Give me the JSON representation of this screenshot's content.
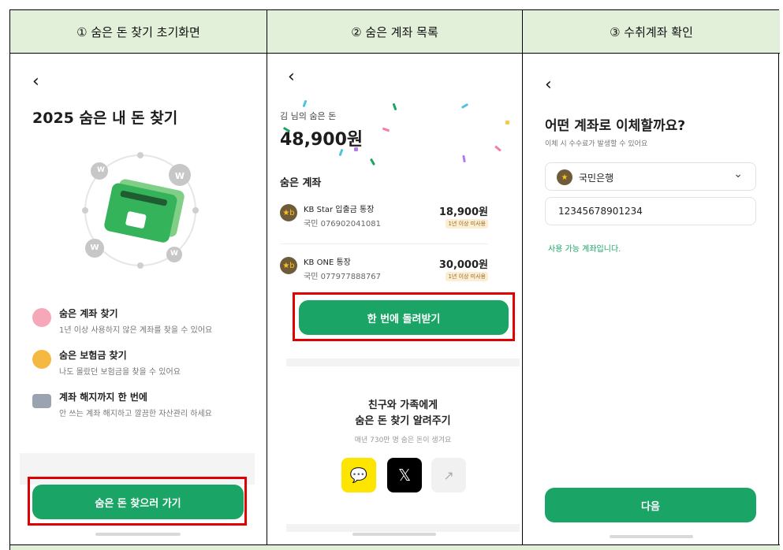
{
  "headers": [
    "① 숨은 돈 찾기 초기화면",
    "② 숨은 계좌 목록",
    "③ 수취계좌 확인"
  ],
  "colors": {
    "header_bg": "#e2f0d9",
    "brand_green": "#1aa566",
    "highlight_red": "#e00000"
  },
  "panel1": {
    "back_icon": "chevron-left-icon",
    "back_glyph": "‹",
    "title": "2025 숨은 내 돈 찾기",
    "coin_glyph": "W",
    "features": [
      {
        "icon": "piggy-bank-icon",
        "title": "숨은 계좌 찾기",
        "desc": "1년 이상 사용하지 않은 계좌를 찾을 수 있어요"
      },
      {
        "icon": "money-bag-icon",
        "title": "숨은 보험금 찾기",
        "desc": "나도 몰랐던 보험금을 찾을 수 있어요"
      },
      {
        "icon": "card-icon",
        "title": "계좌 해지까지 한 번에",
        "desc": "안 쓰는 계좌 해지하고 깔끔한 자산관리 하세요"
      }
    ],
    "cta": "숨은 돈 찾으러 가기"
  },
  "panel2": {
    "back_glyph": "‹",
    "owner": "김    님의 숨은 돈",
    "amount": "48,900원",
    "section": "숨은 계좌",
    "accounts": [
      {
        "name": "KB Star 입출금 통장",
        "number": "국민 076902041081",
        "amount": "18,900원",
        "badge": "1년 이상 미사용"
      },
      {
        "name": "KB ONE 통장",
        "number": "국민 077977888767",
        "amount": "30,000원",
        "badge": "1년 이상 미사용"
      }
    ],
    "kb_glyph": "★b",
    "cta": "한 번에 돌려받기",
    "share_title_1": "친구와 가족에게",
    "share_title_2": "숨은 돈 찾기 알려주기",
    "share_sub": "매년 730만 명 숨은 돈이 생겨요",
    "share_buttons": [
      {
        "icon": "kakao-talk-icon",
        "glyph": "💬",
        "bg": "#fee500"
      },
      {
        "icon": "x-logo-icon",
        "glyph": "𝕏",
        "bg": "#000000"
      },
      {
        "icon": "share-icon",
        "glyph": "↗",
        "bg": "#f1f1f1"
      }
    ]
  },
  "panel3": {
    "back_glyph": "‹",
    "title": "어떤 계좌로 이체할까요?",
    "subtitle": "이체 시 수수료가 발생할 수 있어요",
    "bank": "국민은행",
    "bank_glyph": "★",
    "dropdown_glyph": "⌄",
    "account_number": "12345678901234",
    "status": "사용 가능 계좌입니다.",
    "cta": "다음"
  }
}
